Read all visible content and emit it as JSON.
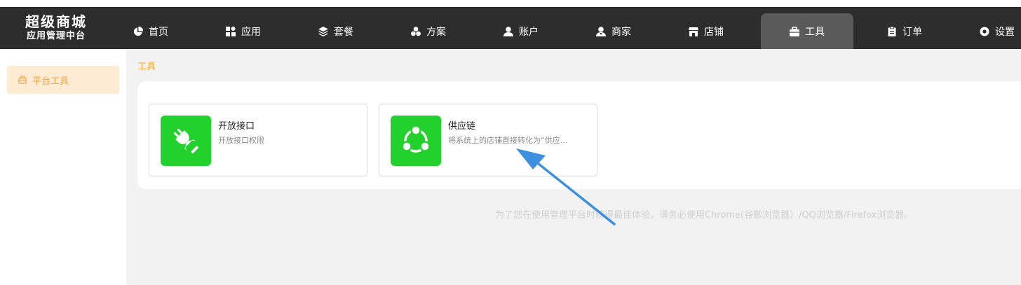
{
  "logo": {
    "title": "超级商城",
    "subtitle": "应用管理中台"
  },
  "nav": {
    "items": [
      {
        "label": "首页",
        "icon": "pie-chart-icon"
      },
      {
        "label": "应用",
        "icon": "apps-grid-icon"
      },
      {
        "label": "套餐",
        "icon": "layers-icon"
      },
      {
        "label": "方案",
        "icon": "cluster-icon"
      },
      {
        "label": "账户",
        "icon": "user-icon"
      },
      {
        "label": "商家",
        "icon": "merchant-user-icon"
      },
      {
        "label": "店铺",
        "icon": "store-icon"
      },
      {
        "label": "工具",
        "icon": "toolbox-icon",
        "active": true
      },
      {
        "label": "订单",
        "icon": "clipboard-icon"
      },
      {
        "label": "设置",
        "icon": "gear-icon"
      }
    ]
  },
  "sidebar": {
    "items": [
      {
        "label": "平台工具",
        "icon": "toolbox-icon",
        "active": true
      }
    ]
  },
  "breadcrumb": "工具",
  "cards": [
    {
      "title": "开放接口",
      "desc": "开放接口权限",
      "icon": "plug-icon"
    },
    {
      "title": "供应链",
      "desc": "将系统上的店铺直接转化为“供应...",
      "icon": "share-network-icon"
    }
  ],
  "notice": "为了您在使用管理平台时获得最佳体验，请务必使用Chrome(谷歌浏览器）/QQ浏览器/Firefox浏览器。",
  "colors": {
    "topbar": "#2d2d2d",
    "accent": "#f5a33a",
    "green": "#22d12b",
    "arrow": "#3d8fe0"
  }
}
